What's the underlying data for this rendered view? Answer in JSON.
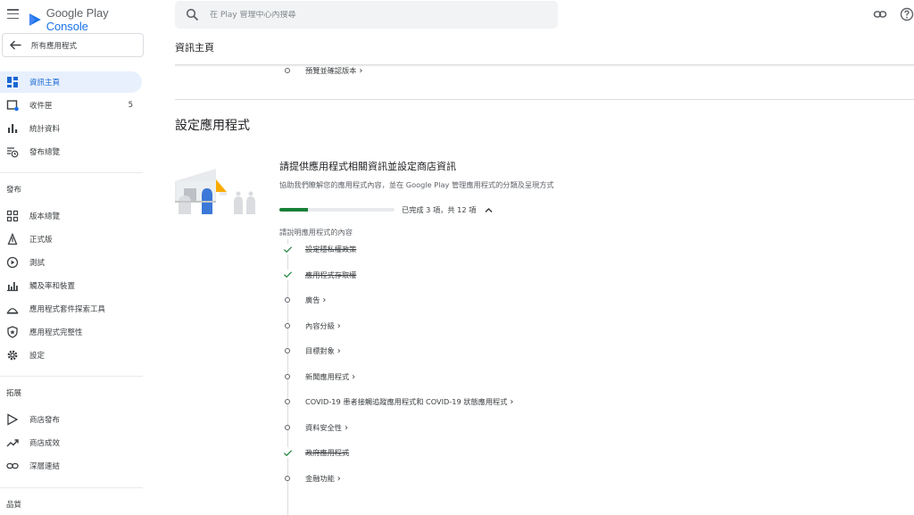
{
  "brand": {
    "prefix": "Google Play",
    "suffix": "Console",
    "color": "#1a73e8"
  },
  "sidebar": {
    "back_label": "所有應用程式",
    "top_items": [
      {
        "label": "資訊主頁",
        "icon": "dashboard-icon",
        "active": true
      },
      {
        "label": "收件匣",
        "icon": "inbox-icon",
        "count": "5"
      },
      {
        "label": "統計資料",
        "icon": "bar-chart-icon"
      },
      {
        "label": "發布總覽",
        "icon": "publishing-overview-icon"
      }
    ],
    "release_title": "發布",
    "release_items": [
      {
        "label": "版本總覽",
        "icon": "grid-icon"
      },
      {
        "label": "正式版",
        "icon": "production-icon"
      },
      {
        "label": "測試",
        "icon": "play-circle-icon"
      },
      {
        "label": "觸及率和裝置",
        "icon": "reach-chart-icon"
      },
      {
        "label": "應用程式套件探索工具",
        "icon": "android-bundle-icon"
      },
      {
        "label": "應用程式完整性",
        "icon": "shield-icon"
      },
      {
        "label": "設定",
        "icon": "gear-icon"
      }
    ],
    "grow_title": "拓展",
    "grow_items": [
      {
        "label": "商店發布",
        "icon": "store-icon"
      },
      {
        "label": "商店成效",
        "icon": "trending-icon"
      },
      {
        "label": "深層連結",
        "icon": "link-icon"
      }
    ],
    "quality_title": "品質"
  },
  "search": {
    "placeholder": "在 Play 管理中心內搜尋"
  },
  "header": {
    "title": "資訊主頁"
  },
  "prev_step": {
    "label": "預覽並確認版本"
  },
  "section": {
    "title": "設定應用程式",
    "card_title": "請提供應用程式相關資訊並設定商店資訊",
    "card_desc": "協助我們瞭解您的應用程式內容，並在 Google Play 管理應用程式的分類及呈現方式",
    "progress_text": "已完成 3 項，共 12 項",
    "progress_fraction": 0.25,
    "group_label": "請說明應用程式的內容",
    "tasks": [
      {
        "label": "設定隱私權政策",
        "done": true
      },
      {
        "label": "應用程式存取權",
        "done": true
      },
      {
        "label": "廣告",
        "done": false
      },
      {
        "label": "內容分級",
        "done": false
      },
      {
        "label": "目標對象",
        "done": false
      },
      {
        "label": "新聞應用程式",
        "done": false
      },
      {
        "label": "COVID-19 患者接觸追蹤應用程式和 COVID-19 狀態應用程式",
        "done": false
      },
      {
        "label": "資料安全性",
        "done": false
      },
      {
        "label": "政府應用程式",
        "done": true
      },
      {
        "label": "金融功能",
        "done": false
      }
    ]
  }
}
